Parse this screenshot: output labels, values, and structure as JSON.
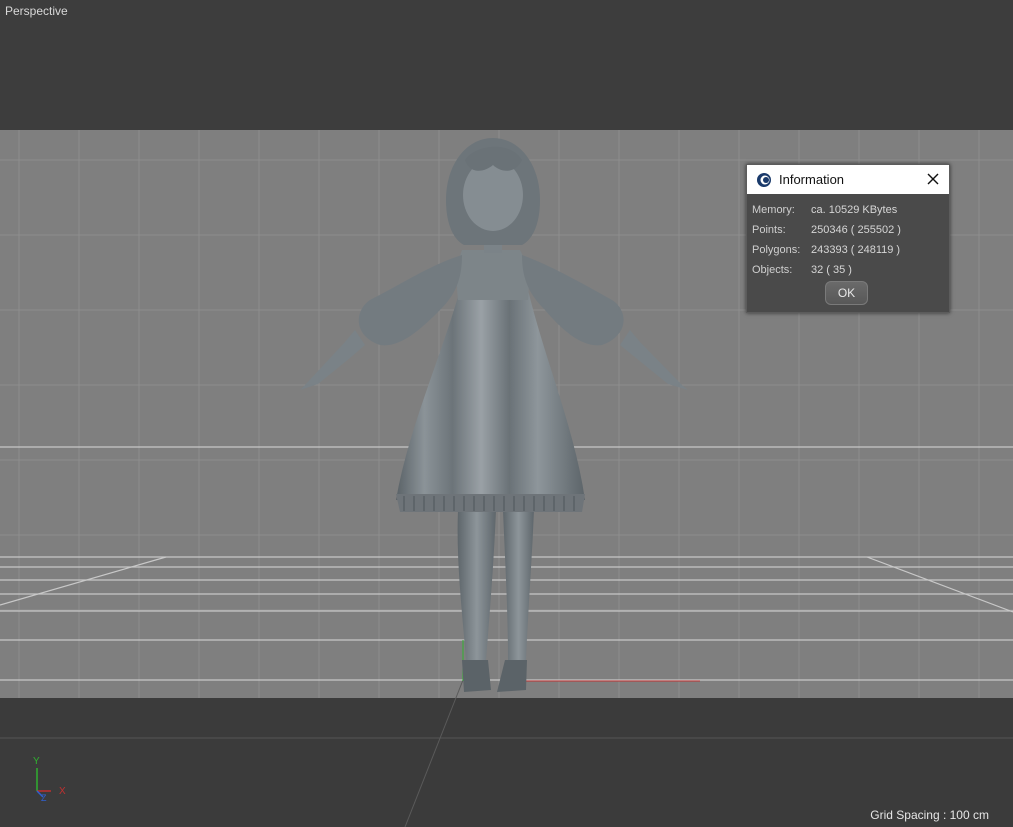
{
  "viewport": {
    "label": "Perspective",
    "grid_spacing": "Grid Spacing : 100 cm"
  },
  "axis_gizmo": {
    "y": "Y",
    "z": "Z",
    "x": "X"
  },
  "dialog": {
    "title": "Information",
    "icon": "cinema4d-logo-icon",
    "rows": [
      {
        "label": "Memory:",
        "value": "ca. 10529 KBytes"
      },
      {
        "label": "Points:",
        "value": "250346 ( 255502 )"
      },
      {
        "label": "Polygons:",
        "value": "243393 ( 248119 )"
      },
      {
        "label": "Objects:",
        "value": "32 ( 35 )"
      }
    ],
    "ok_label": "OK"
  },
  "colors": {
    "backdrop": "#808080",
    "floor": "#3b3b3b",
    "model": "#7e868c",
    "x_axis": "#c03030",
    "y_axis": "#30b030",
    "z_axis": "#3060d0"
  }
}
